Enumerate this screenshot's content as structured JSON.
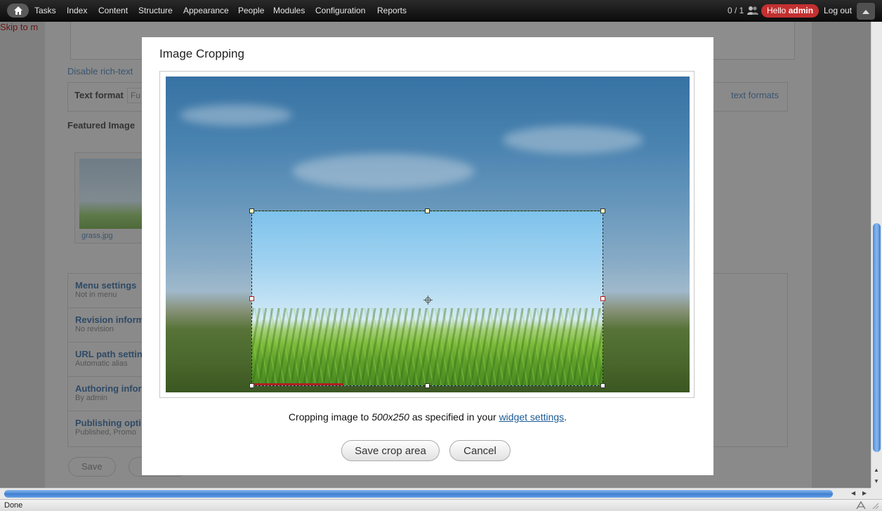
{
  "background": {
    "skip_link": "Skip to m",
    "disable_link": "Disable rich-text",
    "text_format_label": "Text format",
    "text_format_value": "Fu",
    "about_formats": "text formats",
    "featured_image_label": "Featured Image",
    "thumbnail_name": "grass.jpg",
    "vertical_tabs": [
      {
        "title": "Menu settings",
        "summary": "Not in menu"
      },
      {
        "title": "Revision inform",
        "summary": "No revision"
      },
      {
        "title": "URL path settin",
        "summary": "Automatic alias"
      },
      {
        "title": "Authoring infor",
        "summary": "By admin"
      },
      {
        "title": "Publishing opti",
        "summary": "Published, Promo"
      }
    ],
    "save_label": "Save"
  },
  "toolbar": {
    "nav": [
      "Tasks",
      "Index",
      "Content",
      "Structure",
      "Appearance",
      "People",
      "Modules",
      "Configuration",
      "Reports"
    ],
    "user_count": "0 / 1",
    "hello_prefix": "Hello",
    "username": "admin",
    "logout": "Log out"
  },
  "modal": {
    "title": "Image Cropping",
    "caption_before": "Cropping image to",
    "dimensions": "500x250",
    "caption_middle": "as specified in your",
    "settings_link": "widget settings",
    "caption_end": ".",
    "save_label": "Save crop area",
    "cancel_label": "Cancel"
  },
  "status": {
    "text": "Done"
  },
  "colors": {
    "accent_link": "#1a5a96",
    "user_badge": "#c33030",
    "scroll_thumb": "#3f7fd0"
  }
}
